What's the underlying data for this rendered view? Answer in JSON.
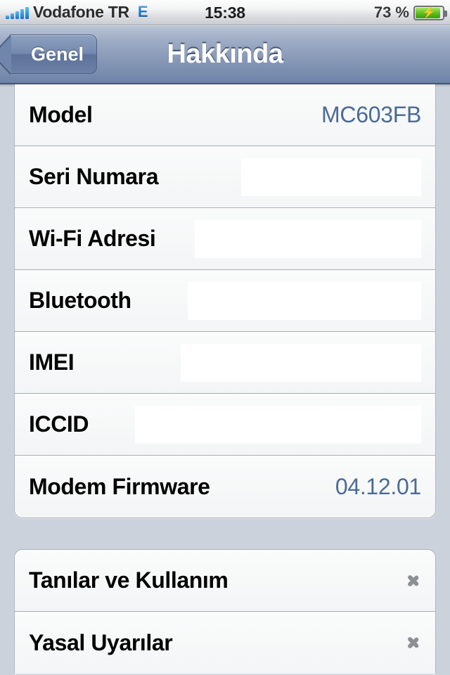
{
  "status_bar": {
    "carrier": "Vodafone TR",
    "network_type": "E",
    "signal_bars": 5,
    "time": "15:38",
    "battery_percent": "73 %",
    "battery_charging": true,
    "battery_level": 73,
    "battery_color": "#5cbc1f",
    "signal_color": "#1073c8"
  },
  "nav_bar": {
    "back_label": "Genel",
    "title": "Hakkında"
  },
  "sections": [
    {
      "id": "device-info",
      "rows": [
        {
          "label": "Model",
          "value": "MC603FB",
          "type": "value"
        },
        {
          "label": "Seri Numara",
          "value": "",
          "type": "redacted",
          "redact_width": 256
        },
        {
          "label": "Wi-Fi Adresi",
          "value": "",
          "type": "redacted",
          "redact_width": 322
        },
        {
          "label": "Bluetooth",
          "value": "",
          "type": "redacted",
          "redact_width": 332
        },
        {
          "label": "IMEI",
          "value": "",
          "type": "redacted",
          "redact_width": 342
        },
        {
          "label": "ICCID",
          "value": "",
          "type": "redacted",
          "redact_width": 407
        },
        {
          "label": "Modem Firmware",
          "value": "04.12.01",
          "type": "value"
        }
      ]
    },
    {
      "id": "diagnostics",
      "rows": [
        {
          "label": "Tanılar ve Kullanım",
          "value": "",
          "type": "disclosure"
        },
        {
          "label": "Yasal Uyarılar",
          "value": "",
          "type": "disclosure"
        }
      ]
    }
  ],
  "colors": {
    "page_background": "#ccd2dc",
    "cell_background": "#f6f7f8",
    "value_text": "#4a6a95",
    "label_text": "#000000",
    "navbar_top": "#b9c4d6",
    "navbar_bottom": "#6d83a8",
    "separator": "#a8aeb8",
    "chevron": "#8c8f94"
  }
}
